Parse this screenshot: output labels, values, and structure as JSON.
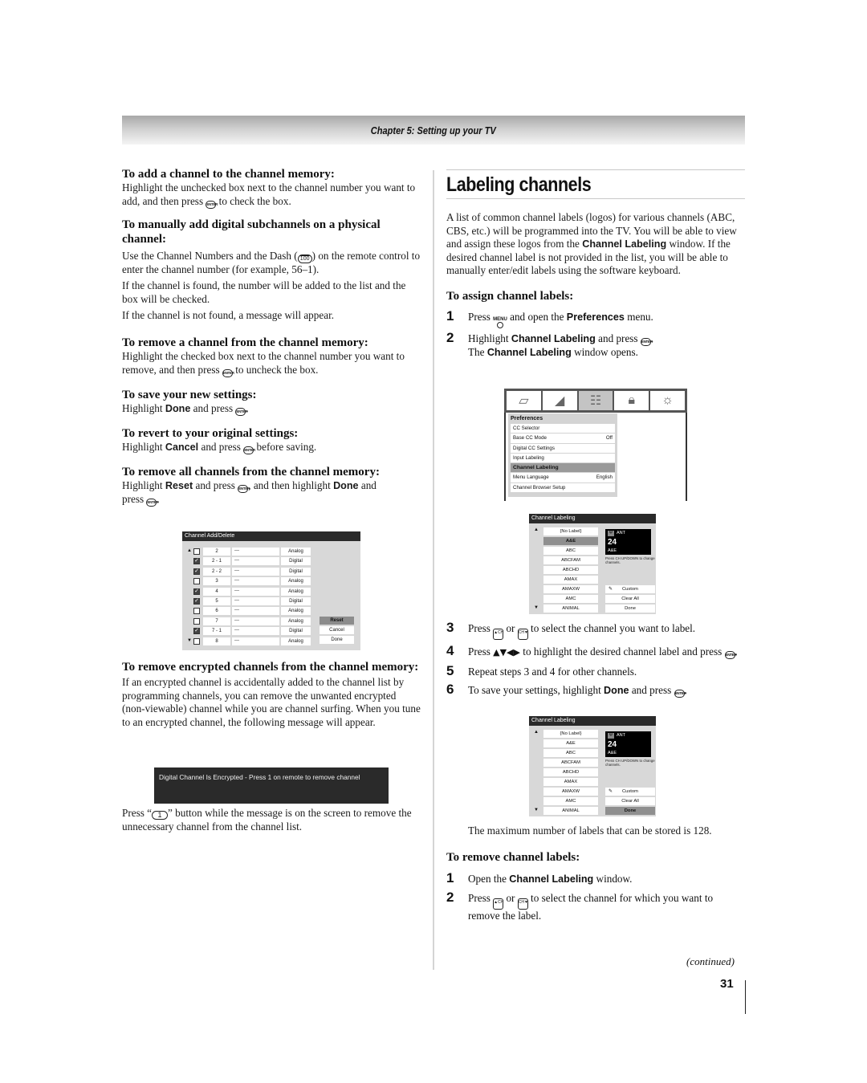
{
  "header": {
    "chapter": "Chapter 5: Setting up your TV"
  },
  "left": {
    "sections": [
      {
        "heading": "To add a channel to the channel memory:",
        "p1a": "Highlight the unchecked box next to the channel number you want to add, and then press",
        "p1b": "to check the box."
      },
      {
        "heading": "To manually add digital subchannels on a physical channel:",
        "p1a": "Use the Channel Numbers and the Dash (",
        "p1b": ") on the remote control to enter the channel number (for example, 56–1).",
        "p2": "If the channel is found, the number will be added to the list and the box will be checked.",
        "p3": "If the channel is not found, a message will appear."
      },
      {
        "heading": "To remove a channel from the channel memory:",
        "p1a": "Highlight the checked box next to the channel number you want to remove, and then press",
        "p1b": "to uncheck the box."
      },
      {
        "heading": "To save your new settings:",
        "p1a": "Highlight",
        "bold": "Done",
        "p1b": "and press",
        "p1c": "."
      },
      {
        "heading": "To revert to your original settings:",
        "p1a": "Highlight",
        "bold": "Cancel",
        "p1b": "and press",
        "p1c": "before saving."
      },
      {
        "heading": "To remove all channels from the channel memory:",
        "p1a": "Highlight",
        "bold": "Reset",
        "p1b": "and press",
        "p1c": ", and then highlight",
        "bold2": "Done",
        "p1d": "and",
        "p1e": "press",
        "p1f": "."
      },
      {
        "heading": "To remove encrypted channels from the channel memory:",
        "p1": "If an encrypted channel is accidentally added to the channel list by programming channels, you can remove the unwanted encrypted (non-viewable) channel while you are channel surfing. When you tune to an encrypted channel, the following message will appear.",
        "p2a": "Press “",
        "p2b": "” button while the message is on the screen to remove the unnecessary channel from the channel list."
      }
    ],
    "channel_add_delete": {
      "title": "Channel Add/Delete",
      "rows": [
        {
          "checked": false,
          "number": "2",
          "name": "---",
          "type": "Analog"
        },
        {
          "checked": true,
          "number": "2 - 1",
          "name": "---",
          "type": "Digital"
        },
        {
          "checked": true,
          "number": "2 - 2",
          "name": "---",
          "type": "Digital"
        },
        {
          "checked": false,
          "number": "3",
          "name": "---",
          "type": "Analog"
        },
        {
          "checked": true,
          "number": "4",
          "name": "---",
          "type": "Analog"
        },
        {
          "checked": true,
          "number": "5",
          "name": "---",
          "type": "Digital"
        },
        {
          "checked": false,
          "number": "6",
          "name": "---",
          "type": "Analog"
        },
        {
          "checked": false,
          "number": "7",
          "name": "---",
          "type": "Analog"
        },
        {
          "checked": true,
          "number": "7 - 1",
          "name": "---",
          "type": "Digital"
        },
        {
          "checked": false,
          "number": "8",
          "name": "---",
          "type": "Analog"
        }
      ],
      "buttons": {
        "reset": "Reset",
        "cancel": "Cancel",
        "done": "Done"
      },
      "selected_button": "reset"
    },
    "encrypted_message": "Digital Channel Is Encrypted - Press 1 on remote to remove channel"
  },
  "right": {
    "title": "Labeling channels",
    "intro_a": "A list of common channel labels (logos) for various channels (ABC, CBS, etc.) will be programmed into the TV. You will be able to view and assign these logos from the",
    "intro_bold": "Channel Labeling",
    "intro_b": "window. If the desired channel label is not provided in the list, you will be able to manually enter/edit labels using the software keyboard.",
    "assign": {
      "heading": "To assign channel labels:",
      "s1": {
        "n": "1",
        "a": "Press",
        "b": "and open the",
        "bold": "Preferences",
        "c": "menu."
      },
      "s2": {
        "n": "2",
        "a": "Highlight",
        "bold": "Channel Labeling",
        "b": "and press",
        "c": ".",
        "d": "The",
        "bold2": "Channel Labeling",
        "e": "window opens."
      },
      "s3": {
        "n": "3",
        "a": "Press",
        "b": "or",
        "c": "to select the channel you want to label."
      },
      "s4": {
        "n": "4",
        "a": "Press",
        "arrows": "▲▼◀▶",
        "b": "to highlight the desired channel label and press",
        "c": "."
      },
      "s5": {
        "n": "5",
        "a": "Repeat steps 3 and 4 for other channels."
      },
      "s6": {
        "n": "6",
        "a": "To save your settings, highlight",
        "bold": "Done",
        "b": "and press",
        "c": "."
      },
      "note": "The maximum number of labels that can be stored is 128."
    },
    "preferences_menu": {
      "icons": [
        "picture-icon",
        "audio-icon",
        "preferences-icon",
        "lock-icon",
        "setup-icon"
      ],
      "selected_icon": 2,
      "title": "Preferences",
      "items": [
        {
          "label": "CC Selector",
          "value": ""
        },
        {
          "label": "Base CC Mode",
          "value": "Off"
        },
        {
          "label": "Digital CC Settings",
          "value": ""
        },
        {
          "label": "Input Labeling",
          "value": ""
        },
        {
          "label": "Channel Labeling",
          "value": "",
          "selected": true
        },
        {
          "label": "Menu Language",
          "value": "English"
        },
        {
          "label": "Channel Browser Setup",
          "value": ""
        }
      ]
    },
    "channel_labeling": {
      "title": "Channel Labeling",
      "labels": [
        "{No Label}",
        "A&E",
        "ABC",
        "ABCFAM",
        "ABCHD",
        "AMAX",
        "AMAXW",
        "AMC",
        "ANIMAL"
      ],
      "labels_2": [
        "{No Label}",
        "A&E",
        "ABC",
        "ABCFAM",
        "ABCHD",
        "AMAX",
        "AMAXW",
        "AMC",
        "ANIMAL"
      ],
      "source": "ANT",
      "channel": "24",
      "current_label": "A&E",
      "hint": "Press CH UP/DOWN to change channels.",
      "buttons": {
        "custom": "Custom",
        "clear_all": "Clear All",
        "done": "Done"
      }
    },
    "remove": {
      "heading": "To remove channel labels:",
      "s1": {
        "n": "1",
        "a": "Open the",
        "bold": "Channel Labeling",
        "b": "window."
      },
      "s2": {
        "n": "2",
        "a": "Press",
        "b": "or",
        "c": "to select the channel for which you want to remove the label."
      }
    }
  },
  "footer": {
    "continued": "(continued)",
    "page_number": "31"
  },
  "icons": {
    "enter": "ENTER",
    "key100": "100",
    "key1": "1",
    "ch_up": "▲CH",
    "ch_down": "CH▼",
    "menu": "MENU"
  }
}
